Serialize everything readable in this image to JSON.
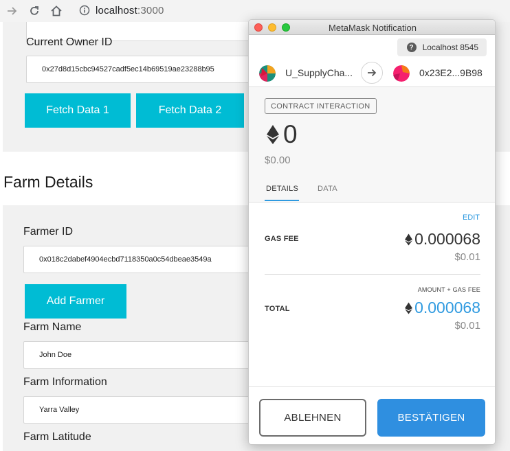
{
  "browser": {
    "host": "localhost",
    "port": ":3000"
  },
  "page": {
    "current_owner": {
      "label": "Current Owner ID",
      "value": "0x27d8d15cbc94527cadf5ec14b69519ae23288b95"
    },
    "fetch_data_1": "Fetch Data 1",
    "fetch_data_2": "Fetch Data 2",
    "farm_section_title": "Farm Details",
    "farmer_id": {
      "label": "Farmer ID",
      "value": "0x018c2dabef4904ecbd7118350a0c54dbeae3549a"
    },
    "add_farmer": "Add Farmer",
    "farm_name": {
      "label": "Farm Name",
      "value": "John Doe"
    },
    "farm_information": {
      "label": "Farm Information",
      "value": "Yarra Valley"
    },
    "farm_latitude": {
      "label": "Farm Latitude"
    }
  },
  "metamask": {
    "window_title": "MetaMask Notification",
    "network": "Localhost 8545",
    "from_name": "U_SupplyCha...",
    "to_address": "0x23E2...9B98",
    "badge": "CONTRACT INTERACTION",
    "eth_amount": "0",
    "usd_amount": "$0.00",
    "tabs": {
      "details": "DETAILS",
      "data": "DATA"
    },
    "edit": "EDIT",
    "gas_fee": {
      "label": "GAS FEE",
      "eth": "0.000068",
      "usd": "$0.01"
    },
    "amount_gas_label": "AMOUNT + GAS FEE",
    "total": {
      "label": "TOTAL",
      "eth": "0.000068",
      "usd": "$0.01"
    },
    "reject": "ABLEHNEN",
    "confirm": "BESTÄTIGEN",
    "colors": {
      "accent_blue": "#2f8fe0",
      "teal": "#00bcd4"
    }
  }
}
